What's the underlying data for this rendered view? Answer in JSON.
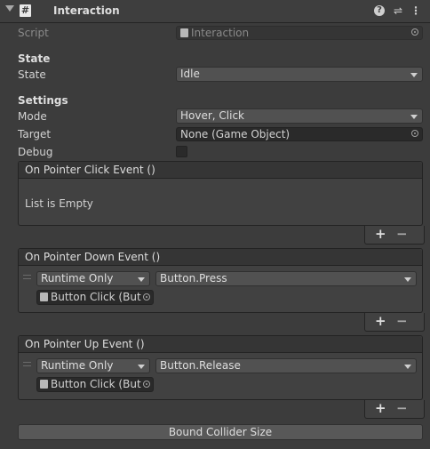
{
  "header": {
    "title": "Interaction",
    "icons": [
      "foldout-arrow",
      "script-icon",
      "help-icon",
      "preset-icon",
      "more-icon"
    ]
  },
  "script": {
    "label": "Script",
    "value": "Interaction"
  },
  "state_section": {
    "heading": "State",
    "state": {
      "label": "State",
      "value": "Idle"
    }
  },
  "settings_section": {
    "heading": "Settings",
    "mode": {
      "label": "Mode",
      "value": "Hover, Click"
    },
    "target": {
      "label": "Target",
      "value": "None (Game Object)"
    },
    "debug": {
      "label": "Debug",
      "checked": false
    }
  },
  "events": [
    {
      "title": "On Pointer Click Event ()",
      "empty_text": "List is Empty",
      "entries": []
    },
    {
      "title": "On Pointer Down Event ()",
      "entries": [
        {
          "runtime": "Runtime Only",
          "function": "Button.Press",
          "object": "Button Click (But"
        }
      ]
    },
    {
      "title": "On Pointer Up Event ()",
      "entries": [
        {
          "runtime": "Runtime Only",
          "function": "Button.Release",
          "object": "Button Click (But"
        }
      ]
    }
  ],
  "list_buttons": {
    "add": "+",
    "remove": "−"
  },
  "bottom_button": "Bound Collider Size",
  "colors": {
    "background": "#3c3c3c",
    "field": "#2a2a2a",
    "dropdown": "#515151",
    "text": "#d2d2d2"
  }
}
